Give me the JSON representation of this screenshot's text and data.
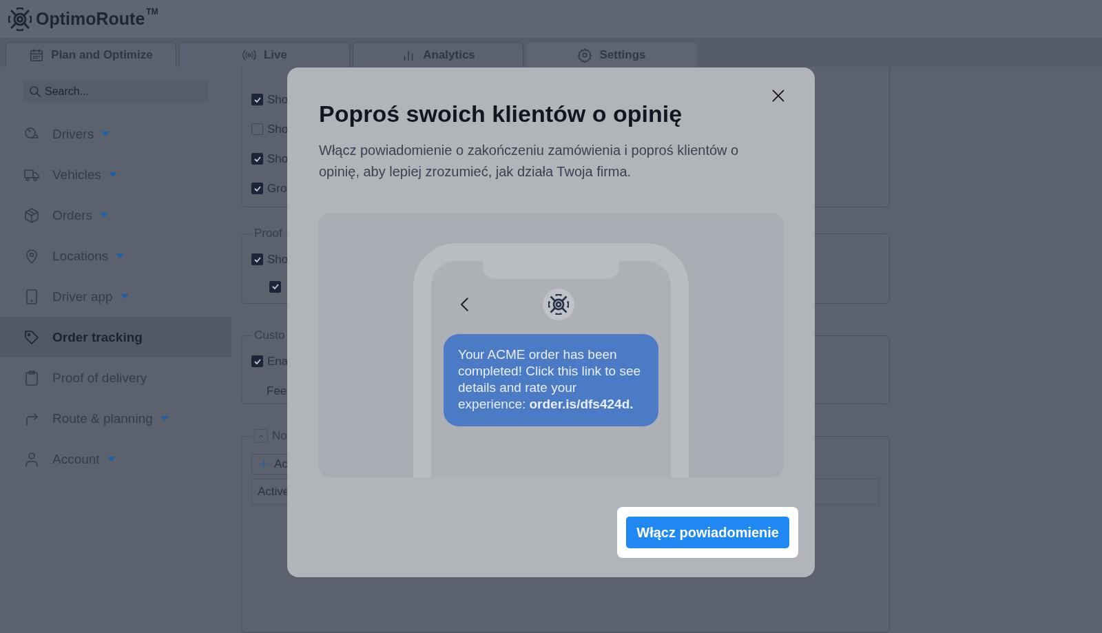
{
  "header": {
    "logo": "OptimoRoute",
    "trademark": "TM"
  },
  "tabs": [
    {
      "label": "Plan and Optimize",
      "selected": false
    },
    {
      "label": "Live",
      "selected": false
    },
    {
      "label": "Analytics",
      "selected": false
    },
    {
      "label": "Settings",
      "selected": true
    }
  ],
  "sidebar": {
    "search": {
      "placeholder": "Search..."
    },
    "items": [
      {
        "label": "Drivers",
        "has_menu": true,
        "selected": false
      },
      {
        "label": "Vehicles",
        "has_menu": true,
        "selected": false
      },
      {
        "label": "Orders",
        "has_menu": true,
        "selected": false
      },
      {
        "label": "Locations",
        "has_menu": true,
        "selected": false
      },
      {
        "label": "Driver app",
        "has_menu": true,
        "selected": false
      },
      {
        "label": "Order tracking",
        "has_menu": false,
        "selected": true
      },
      {
        "label": "Proof of delivery",
        "has_menu": false,
        "selected": false
      },
      {
        "label": "Route & planning",
        "has_menu": true,
        "selected": false
      },
      {
        "label": "Account",
        "has_menu": true,
        "selected": false
      }
    ]
  },
  "settings": {
    "groups": [
      {
        "rows": [
          {
            "kind": "checkbox",
            "label": "Sho",
            "checked": true
          },
          {
            "kind": "checkbox",
            "label": "Sho",
            "checked": false
          },
          {
            "kind": "checkbox",
            "label": "Sho",
            "checked": true
          },
          {
            "kind": "checkbox",
            "label": "Gro",
            "checked": true
          }
        ]
      },
      {
        "legend": "Proof",
        "rows": [
          {
            "kind": "checkbox",
            "label": "Sho",
            "checked": true,
            "children": [
              {
                "kind": "checkbox",
                "checked": true
              }
            ]
          }
        ]
      },
      {
        "legend": "Custo",
        "rows": [
          {
            "kind": "checkbox",
            "label": "Ena",
            "checked": true
          },
          {
            "kind": "text",
            "label": "Fee"
          }
        ]
      },
      {
        "legend": "No",
        "collapsible": true,
        "expanded": true,
        "rows": [
          {
            "kind": "button",
            "label": "Ac"
          },
          {
            "kind": "table_header",
            "label": "Active"
          }
        ]
      }
    ]
  },
  "modal": {
    "title": "Poproś swoich klientów o opinię",
    "body": "Włącz powiadomienie o zakończeniu zamówienia i poproś klientów o opinię, aby lepiej zrozumieć, jak działa Twoja firma.",
    "message": "Your ACME order has been completed! Click this link to see details and rate your experience: **order.is/dfs424d.**",
    "button": "Włącz powiadomienie"
  }
}
